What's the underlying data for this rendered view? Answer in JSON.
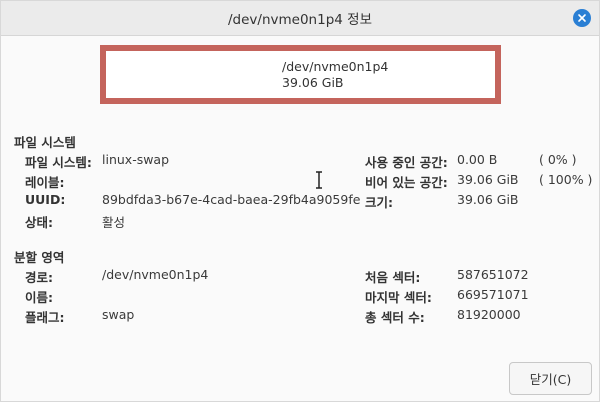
{
  "window": {
    "title": "/dev/nvme0n1p4 정보"
  },
  "partition_box": {
    "device": "/dev/nvme0n1p4",
    "size": "39.06 GiB",
    "color": "#c4645c"
  },
  "filesystem": {
    "heading": "파일 시스템",
    "left": [
      {
        "label": "파일 시스템:",
        "value": "linux-swap"
      },
      {
        "label": "레이블:",
        "value": ""
      },
      {
        "label": "UUID:",
        "value": "89bdfda3-b67e-4cad-baea-29fb4a9059fe"
      },
      {
        "label": "상태:",
        "value": "활성"
      }
    ],
    "right": [
      {
        "label": "사용 중인 공간:",
        "value": "0.00 B",
        "pct": "( 0% )"
      },
      {
        "label": "비어 있는 공간:",
        "value": "39.06 GiB",
        "pct": "( 100% )"
      },
      {
        "label": "크기:",
        "value": "39.06 GiB",
        "pct": ""
      }
    ]
  },
  "partition": {
    "heading": "분할 영역",
    "left": [
      {
        "label": "경로:",
        "value": "/dev/nvme0n1p4"
      },
      {
        "label": "이름:",
        "value": ""
      },
      {
        "label": "플래그:",
        "value": "swap"
      }
    ],
    "right": [
      {
        "label": "처음 섹터:",
        "value": "587651072"
      },
      {
        "label": "마지막 섹터:",
        "value": "669571071"
      },
      {
        "label": "총 섹터 수:",
        "value": "81920000"
      }
    ]
  },
  "buttons": {
    "close": "닫기(C)"
  },
  "icons": {
    "close": "close-icon",
    "cursor": "text-cursor-icon"
  }
}
